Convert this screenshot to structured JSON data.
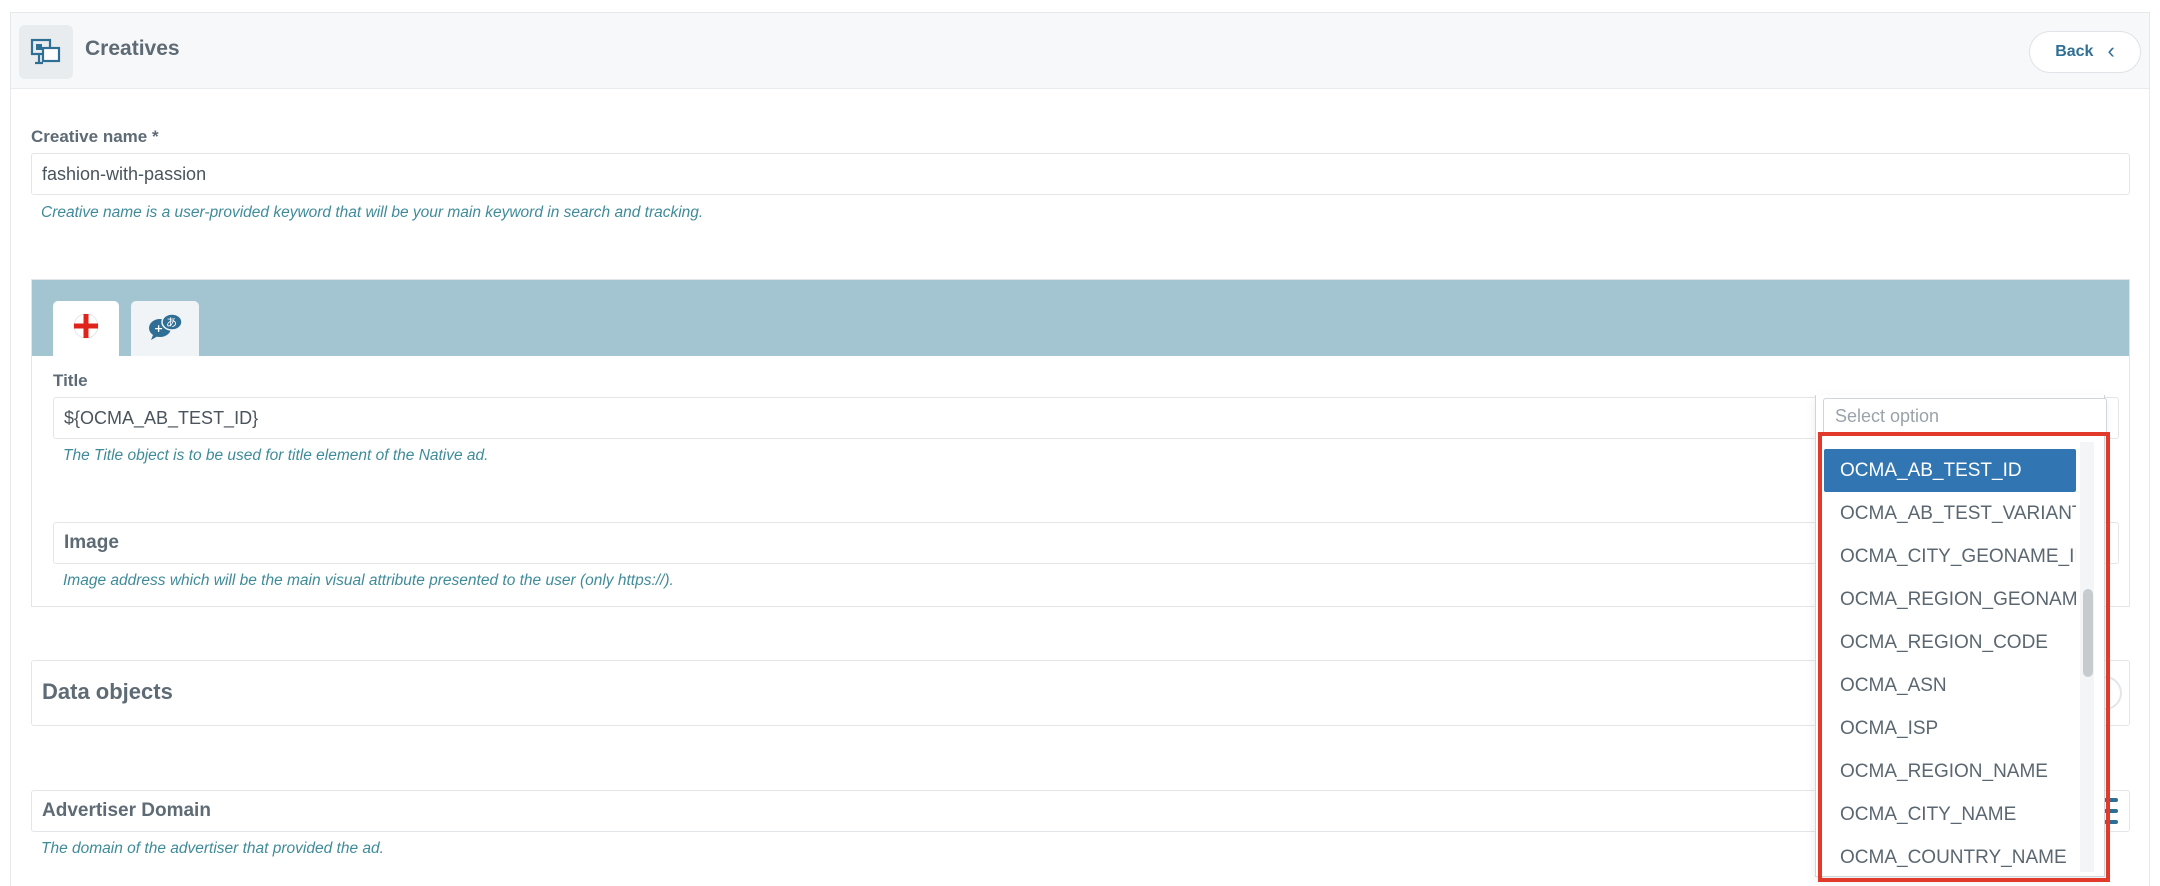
{
  "header": {
    "title": "Creatives",
    "back_label": "Back",
    "icon": "creatives-icon"
  },
  "creative_name": {
    "label": "Creative name *",
    "value": "fashion-with-passion",
    "help": "Creative name is a user-provided keyword that will be your main keyword in search and tracking."
  },
  "tabs": [
    {
      "icon": "english-flag-icon"
    },
    {
      "icon": "translate-icon"
    }
  ],
  "title_field": {
    "label": "Title",
    "value": "${OCMA_AB_TEST_ID}",
    "help": "The Title object is to be used for title element of the Native ad."
  },
  "image_field": {
    "label": "Image",
    "help": "Image address which will be the main visual attribute presented to the user (only https://)."
  },
  "data_objects": {
    "title": "Data objects"
  },
  "advertiser_domain": {
    "label": "Advertiser Domain",
    "help": "The domain of the advertiser that provided the ad."
  },
  "dropdown": {
    "placeholder": "Select option",
    "selected": "OCMA_AB_TEST_ID",
    "options": [
      "OCMA_AB_TEST_ID",
      "OCMA_AB_TEST_VARIANT_ID",
      "OCMA_CITY_GEONAME_ID",
      "OCMA_REGION_GEONAME_ID",
      "OCMA_REGION_CODE",
      "OCMA_ASN",
      "OCMA_ISP",
      "OCMA_REGION_NAME",
      "OCMA_CITY_NAME",
      "OCMA_COUNTRY_NAME"
    ]
  },
  "colors": {
    "accent": "#3275b3",
    "tabbar": "#a3c4d1",
    "help_text": "#3f8b9a",
    "highlight": "#e23a2a"
  }
}
